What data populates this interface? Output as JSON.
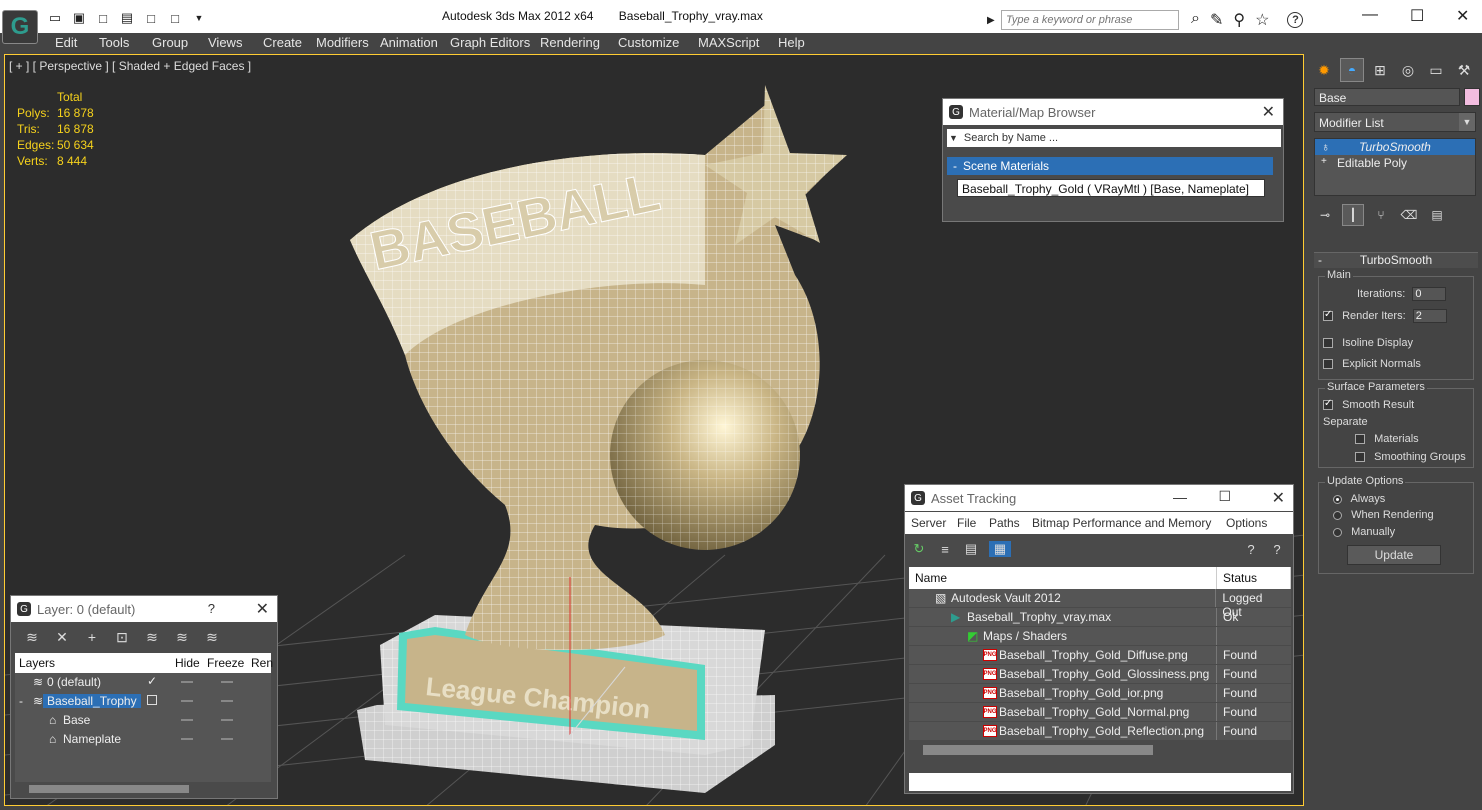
{
  "titlebar": {
    "app_name": "Autodesk 3ds Max  2012 x64",
    "file_name": "Baseball_Trophy_vray.max",
    "search_placeholder": "Type a keyword or phrase"
  },
  "menu": [
    "Edit",
    "Tools",
    "Group",
    "Views",
    "Create",
    "Modifiers",
    "Animation",
    "Graph Editors",
    "Rendering",
    "Customize",
    "MAXScript",
    "Help"
  ],
  "viewport": {
    "label": "[ + ] [ Perspective ] [ Shaded + Edged Faces ]",
    "stats": {
      "header": "Total",
      "polys_label": "Polys:",
      "polys": "16 878",
      "tris_label": "Tris:",
      "tris": "16 878",
      "edges_label": "Edges:",
      "edges": "50 634",
      "verts_label": "Verts:",
      "verts": "8 444"
    },
    "trophy_text": {
      "top": "BASEBALL",
      "plate": "League Champion"
    }
  },
  "material_browser": {
    "title": "Material/Map Browser",
    "search_placeholder": "Search by Name ...",
    "group": "Scene Materials",
    "items": [
      "Baseball_Trophy_Gold  ( VRayMtl ) [Base, Nameplate]"
    ]
  },
  "asset_tracking": {
    "title": "Asset Tracking",
    "menu": [
      "Server",
      "File",
      "Paths",
      "Bitmap Performance and Memory",
      "Options"
    ],
    "columns": [
      "Name",
      "Status"
    ],
    "rows": [
      {
        "name": "Autodesk Vault 2012",
        "status": "Logged Out"
      },
      {
        "name": "Baseball_Trophy_vray.max",
        "status": "Ok"
      },
      {
        "name": "Maps / Shaders",
        "status": ""
      },
      {
        "name": "Baseball_Trophy_Gold_Diffuse.png",
        "status": "Found"
      },
      {
        "name": "Baseball_Trophy_Gold_Glossiness.png",
        "status": "Found"
      },
      {
        "name": "Baseball_Trophy_Gold_ior.png",
        "status": "Found"
      },
      {
        "name": "Baseball_Trophy_Gold_Normal.png",
        "status": "Found"
      },
      {
        "name": "Baseball_Trophy_Gold_Reflection.png",
        "status": "Found"
      }
    ],
    "png_badge": "PNG"
  },
  "layer_panel": {
    "title": "Layer: 0 (default)",
    "help": "?",
    "columns": [
      "Layers",
      "Hide",
      "Freeze",
      "Ren"
    ],
    "rows": [
      {
        "name": "0 (default)",
        "level": 0
      },
      {
        "name": "Baseball_Trophy",
        "level": 0
      },
      {
        "name": "Base",
        "level": 1
      },
      {
        "name": "Nameplate",
        "level": 1
      }
    ]
  },
  "command_panel": {
    "object_name": "Base",
    "object_color": "#f3bde0",
    "modifier_list": "Modifier List",
    "stack": [
      "TurboSmooth",
      "Editable Poly"
    ],
    "rollout_title": "TurboSmooth",
    "main_group": "Main",
    "iterations_label": "Iterations:",
    "iterations": "0",
    "render_iters_label": "Render Iters:",
    "render_iters": "2",
    "isoline_label": "Isoline Display",
    "explicit_normals_label": "Explicit Normals",
    "surface_group": "Surface Parameters",
    "smooth_result_label": "Smooth Result",
    "separate_label": "Separate",
    "materials_label": "Materials",
    "smoothing_groups_label": "Smoothing Groups",
    "update_group": "Update Options",
    "always_label": "Always",
    "when_rendering_label": "When Rendering",
    "manually_label": "Manually",
    "update_button": "Update"
  },
  "colors": {
    "accent_blue": "#2c6fb5",
    "viewport_border": "#ffcc33",
    "stats_yellow": "#f6d21c",
    "trophy_gold": "#c7b48a",
    "nameplate_teal": "#5ad8c2"
  }
}
